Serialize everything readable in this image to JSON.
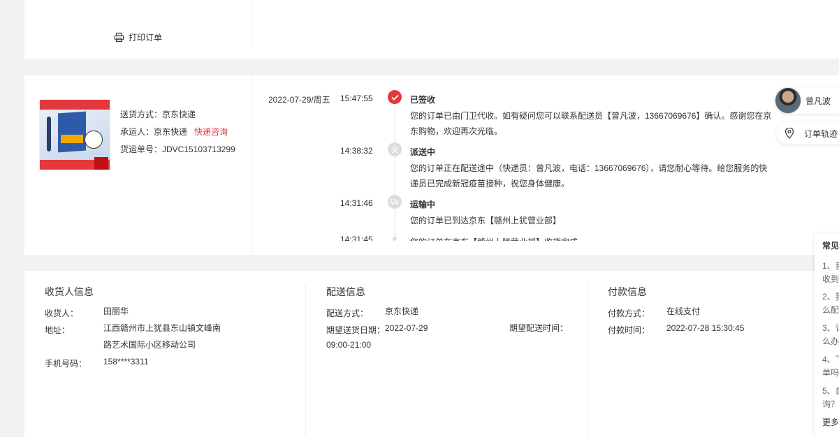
{
  "top": {
    "print_label": "打印订单"
  },
  "shipment": {
    "method_label": "送货方式：",
    "method": "京东快递",
    "carrier_label": "承运人：",
    "carrier": "京东快递",
    "consult_link": "快递咨询",
    "waybill_label": "货运单号：",
    "waybill": "JDVC15103713299"
  },
  "tracking": [
    {
      "date": "2022-07-29/周五",
      "time": "15:47:55",
      "status": "已签收",
      "desc": "您的订单已由门卫代收。如有疑问您可以联系配送员【曾凡波，13667069676】确认。感谢您在京东购物，欢迎再次光临。"
    },
    {
      "date": "",
      "time": "14:38:32",
      "status": "派送中",
      "desc": "您的订单正在配送途中（快递员：曾凡波，电话：13667069676），请您耐心等待。给您服务的快递员已完成新冠疫苗接种，祝您身体健康。"
    },
    {
      "date": "",
      "time": "14:31:46",
      "status": "运输中",
      "desc": "您的订单已到达京东【赣州上犹营业部】"
    },
    {
      "date": "",
      "time": "14:31:45",
      "status": "",
      "desc": "您的订单在京东【赣州上犹营业部】收货完成"
    }
  ],
  "courier": {
    "name": "曾凡波"
  },
  "trace_button": {
    "label": "订单轨迹"
  },
  "faq": {
    "title": "常见",
    "items": [
      "1、我",
      "收到",
      "2、我",
      "么配",
      "3、订",
      "么办",
      "4、下",
      "单吗",
      "5、自",
      "询？",
      "更多"
    ]
  },
  "receiver": {
    "heading": "收货人信息",
    "name_label": "收货人：",
    "name": "田丽华",
    "address_label": "地址：",
    "address_line1": "江西赣州市上犹县东山镇文峰南",
    "address_line2": "路艺术国际小区移动公司",
    "phone_label": "手机号码：",
    "phone": "158****3311"
  },
  "delivery": {
    "heading": "配送信息",
    "method_label": "配送方式：",
    "method": "京东快递",
    "date_label": "期望送货日期：",
    "date": "2022-07-29",
    "time_label": "期望配送时间：",
    "hours": "09:00-21:00"
  },
  "payment": {
    "heading": "付款信息",
    "method_label": "付款方式：",
    "method": "在线支付",
    "time_label": "付款时间：",
    "time": "2022-07-28 15:30:45"
  },
  "colors": {
    "accent": "#e4393c",
    "background": "#f2f2f2",
    "panel": "#ffffff"
  }
}
